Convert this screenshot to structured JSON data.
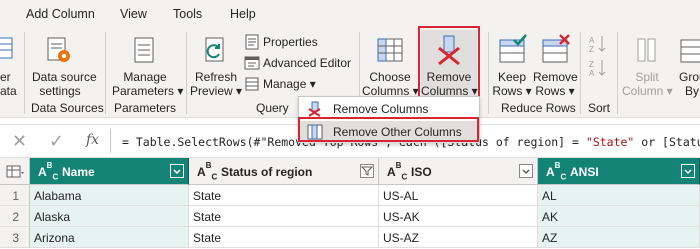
{
  "menu": {
    "items": [
      {
        "label": "Add Column"
      },
      {
        "label": "View"
      },
      {
        "label": "Tools"
      },
      {
        "label": "Help"
      }
    ]
  },
  "ribbon": {
    "cut_left_top": "er",
    "cut_left_bottom": "ata",
    "data_source_settings": {
      "line1": "Data source",
      "line2": "settings"
    },
    "manage_parameters": {
      "line1": "Manage",
      "line2": "Parameters ▾"
    },
    "refresh_preview": {
      "line1": "Refresh",
      "line2": "Preview ▾"
    },
    "properties": "Properties",
    "advanced_editor": "Advanced Editor",
    "manage": "Manage ▾",
    "choose_columns": {
      "line1": "Choose",
      "line2": "Columns ▾"
    },
    "remove_columns": {
      "line1": "Remove",
      "line2": "Columns ▾"
    },
    "keep_rows": {
      "line1": "Keep",
      "line2": "Rows ▾"
    },
    "remove_rows": {
      "line1": "Remove",
      "line2": "Rows ▾"
    },
    "split_column": {
      "line1": "Split",
      "line2": "Column ▾"
    },
    "group_by": {
      "line1": "Grou",
      "line2": "By"
    },
    "groups": {
      "data_sources": "Data Sources",
      "parameters": "Parameters",
      "query": "Query",
      "reduce_rows": "Reduce Rows",
      "sort": "Sort"
    }
  },
  "dropdown": {
    "items": [
      {
        "label": "Remove Columns"
      },
      {
        "label": "Remove Other Columns"
      }
    ]
  },
  "formula_bar": {
    "fx": "fx",
    "prefix": "= Table.SelectRows(#\"Remove",
    "middle_hidden": "d Top Rows\", each ([Status of region] = ",
    "string": "\"State\"",
    "suffix": " or [Status of"
  },
  "table": {
    "columns": [
      {
        "type": "ABC",
        "name": "Name"
      },
      {
        "type": "ABC",
        "name": "Status of region"
      },
      {
        "type": "ABC",
        "name": "ISO"
      },
      {
        "type": "ABC",
        "name": "ANSI"
      }
    ],
    "rows": [
      {
        "num": "1",
        "cells": [
          "Alabama",
          "State",
          "US-AL",
          "AL"
        ]
      },
      {
        "num": "2",
        "cells": [
          "Alaska",
          "State",
          "US-AK",
          "AK"
        ]
      },
      {
        "num": "3",
        "cells": [
          "Arizona",
          "State",
          "US-AZ",
          "AZ"
        ]
      }
    ]
  },
  "colors": {
    "accent": "#138375",
    "highlight": "#d9252f",
    "ribbon_bg": "#f3f2f1"
  }
}
